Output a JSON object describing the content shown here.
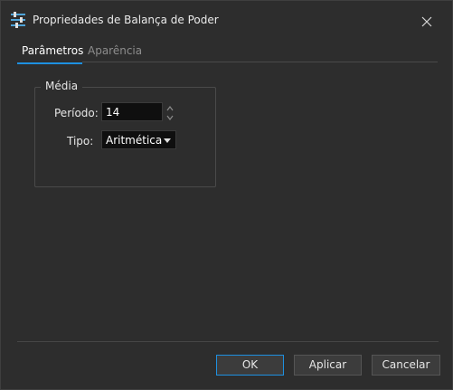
{
  "window": {
    "title": "Propriedades de Balança de Poder",
    "icon": "sliders-icon",
    "close_icon": "close-icon"
  },
  "tabs": [
    {
      "label": "Parâmetros",
      "active": true
    },
    {
      "label": "Aparência",
      "active": false
    }
  ],
  "group": {
    "legend": "Média",
    "periodo": {
      "label": "Período:",
      "value": "14"
    },
    "tipo": {
      "label": "Tipo:",
      "value": "Aritmética"
    }
  },
  "buttons": {
    "ok": "OK",
    "apply": "Aplicar",
    "cancel": "Cancelar"
  },
  "colors": {
    "accent": "#1e90e0",
    "background": "#2d2d2d",
    "input_background": "#0f0f0f"
  }
}
